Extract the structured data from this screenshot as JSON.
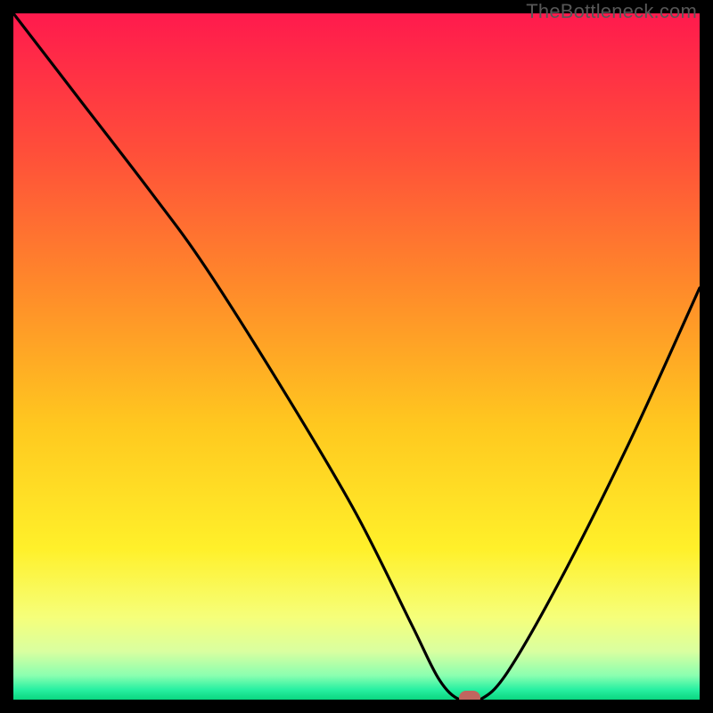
{
  "watermark": "TheBottleneck.com",
  "chart_data": {
    "type": "line",
    "title": "",
    "xlabel": "",
    "ylabel": "",
    "xlim": [
      0,
      100
    ],
    "ylim": [
      0,
      100
    ],
    "grid": false,
    "legend": false,
    "series": [
      {
        "name": "bottleneck-curve",
        "x": [
          0,
          10,
          20,
          28,
          40,
          50,
          58,
          62,
          65,
          68,
          72,
          80,
          90,
          100
        ],
        "values": [
          100,
          87,
          74,
          63,
          44,
          27,
          11,
          3,
          0,
          0,
          4,
          18,
          38,
          60
        ]
      }
    ],
    "marker": {
      "x": 66.5,
      "y": 0,
      "color": "#c1665f"
    },
    "gradient_stops": [
      {
        "offset": 0.0,
        "color": "#ff1a4d"
      },
      {
        "offset": 0.2,
        "color": "#ff4e3a"
      },
      {
        "offset": 0.4,
        "color": "#ff8a2a"
      },
      {
        "offset": 0.6,
        "color": "#ffc81f"
      },
      {
        "offset": 0.78,
        "color": "#fff02a"
      },
      {
        "offset": 0.88,
        "color": "#f6ff7a"
      },
      {
        "offset": 0.93,
        "color": "#d9ffa0"
      },
      {
        "offset": 0.965,
        "color": "#8affb0"
      },
      {
        "offset": 0.985,
        "color": "#29f0a2"
      },
      {
        "offset": 1.0,
        "color": "#0ad680"
      }
    ]
  }
}
